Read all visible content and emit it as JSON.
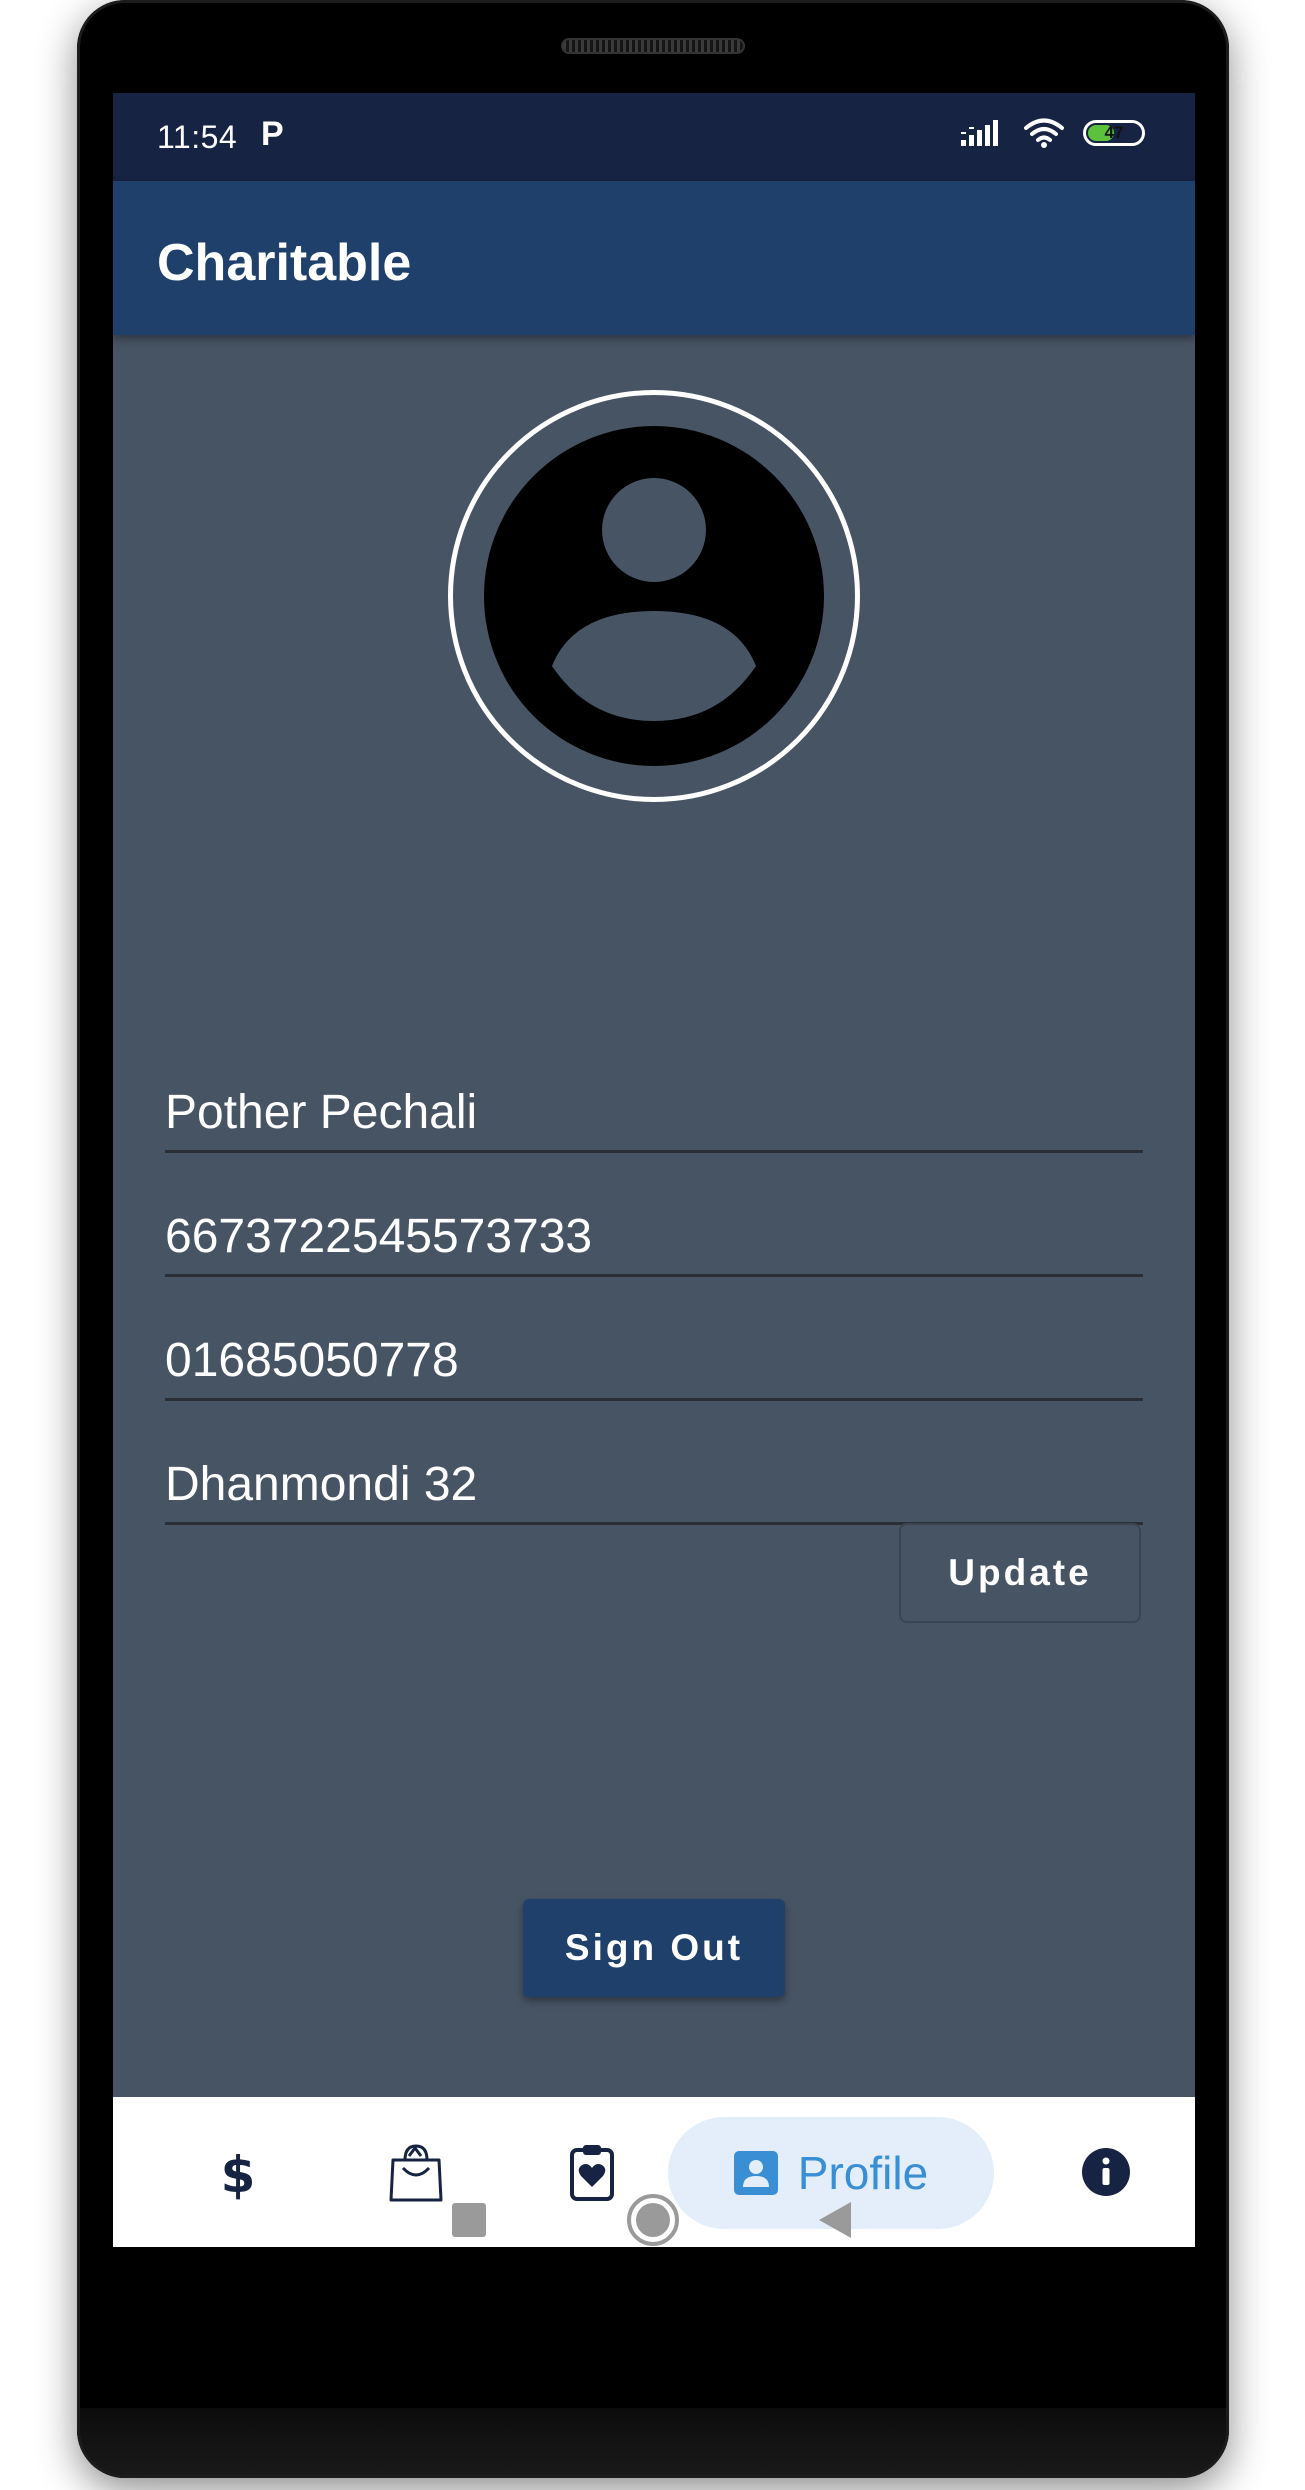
{
  "status_bar": {
    "time": "11:54",
    "notification_icon": "p",
    "battery": "47",
    "battery_level": 0.47
  },
  "app_bar": {
    "title": "Charitable"
  },
  "profile": {
    "avatar_icon": "account-circle-icon",
    "fields": [
      {
        "value": "Pother Pechali"
      },
      {
        "value": "6673722545573733"
      },
      {
        "value": "01685050778"
      },
      {
        "value": "Dhanmondi 32"
      }
    ],
    "update_label": "Update",
    "signout_label": "Sign Out"
  },
  "bottom_nav": {
    "items": [
      {
        "icon": "dollar-icon"
      },
      {
        "icon": "shopping-bag-icon"
      },
      {
        "icon": "clipboard-heart-icon"
      },
      {
        "icon": "account-box-icon",
        "label": "Profile",
        "selected": true
      },
      {
        "icon": "info-icon"
      }
    ]
  },
  "system_nav": {
    "buttons": [
      "recents-square-icon",
      "home-circle-icon",
      "back-triangle-icon"
    ]
  },
  "colors": {
    "status_bar": "#172342",
    "app_bar": "#1f406a",
    "background": "#475464",
    "accent": "#3a8fd4",
    "profile_pill": "#e3eefa",
    "nav_icon": "#172342"
  }
}
